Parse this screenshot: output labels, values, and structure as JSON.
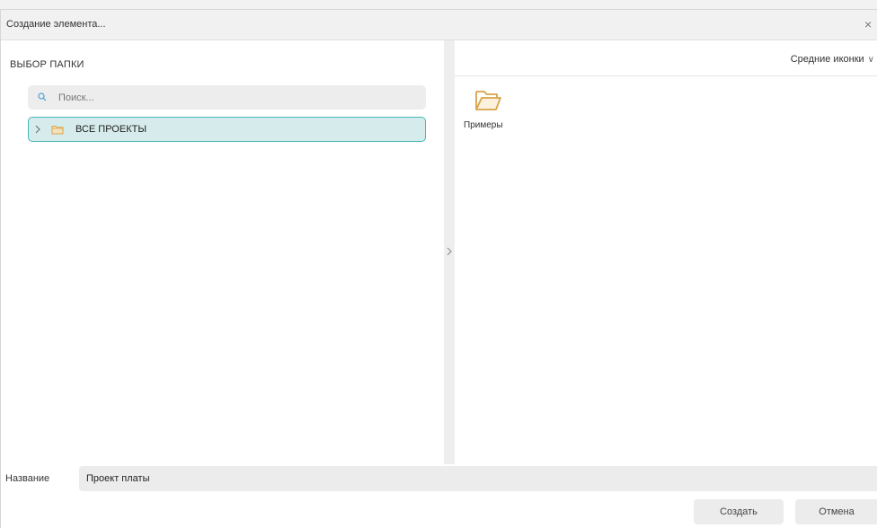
{
  "window": {
    "title": "Создание элемента...",
    "close_glyph": "×"
  },
  "left_pane": {
    "heading": "ВЫБОР ПАПКИ",
    "search": {
      "placeholder": "Поиск...",
      "value": ""
    },
    "tree": [
      {
        "label": "ВСЕ ПРОЕКТЫ",
        "expanded": false,
        "selected": true,
        "icon": "folder-icon"
      }
    ]
  },
  "right_pane": {
    "view_mode": {
      "label": "Средние иконки",
      "chevron": "∨"
    },
    "items": [
      {
        "label": "Примеры",
        "icon": "folder-open-icon"
      }
    ]
  },
  "name_field": {
    "label": "Название",
    "value": "Проект платы"
  },
  "buttons": {
    "create": "Создать",
    "cancel": "Отмена"
  },
  "colors": {
    "selection_bg": "#d6ecec",
    "selection_border": "#45b7b5",
    "folder": "#d9a34a"
  }
}
